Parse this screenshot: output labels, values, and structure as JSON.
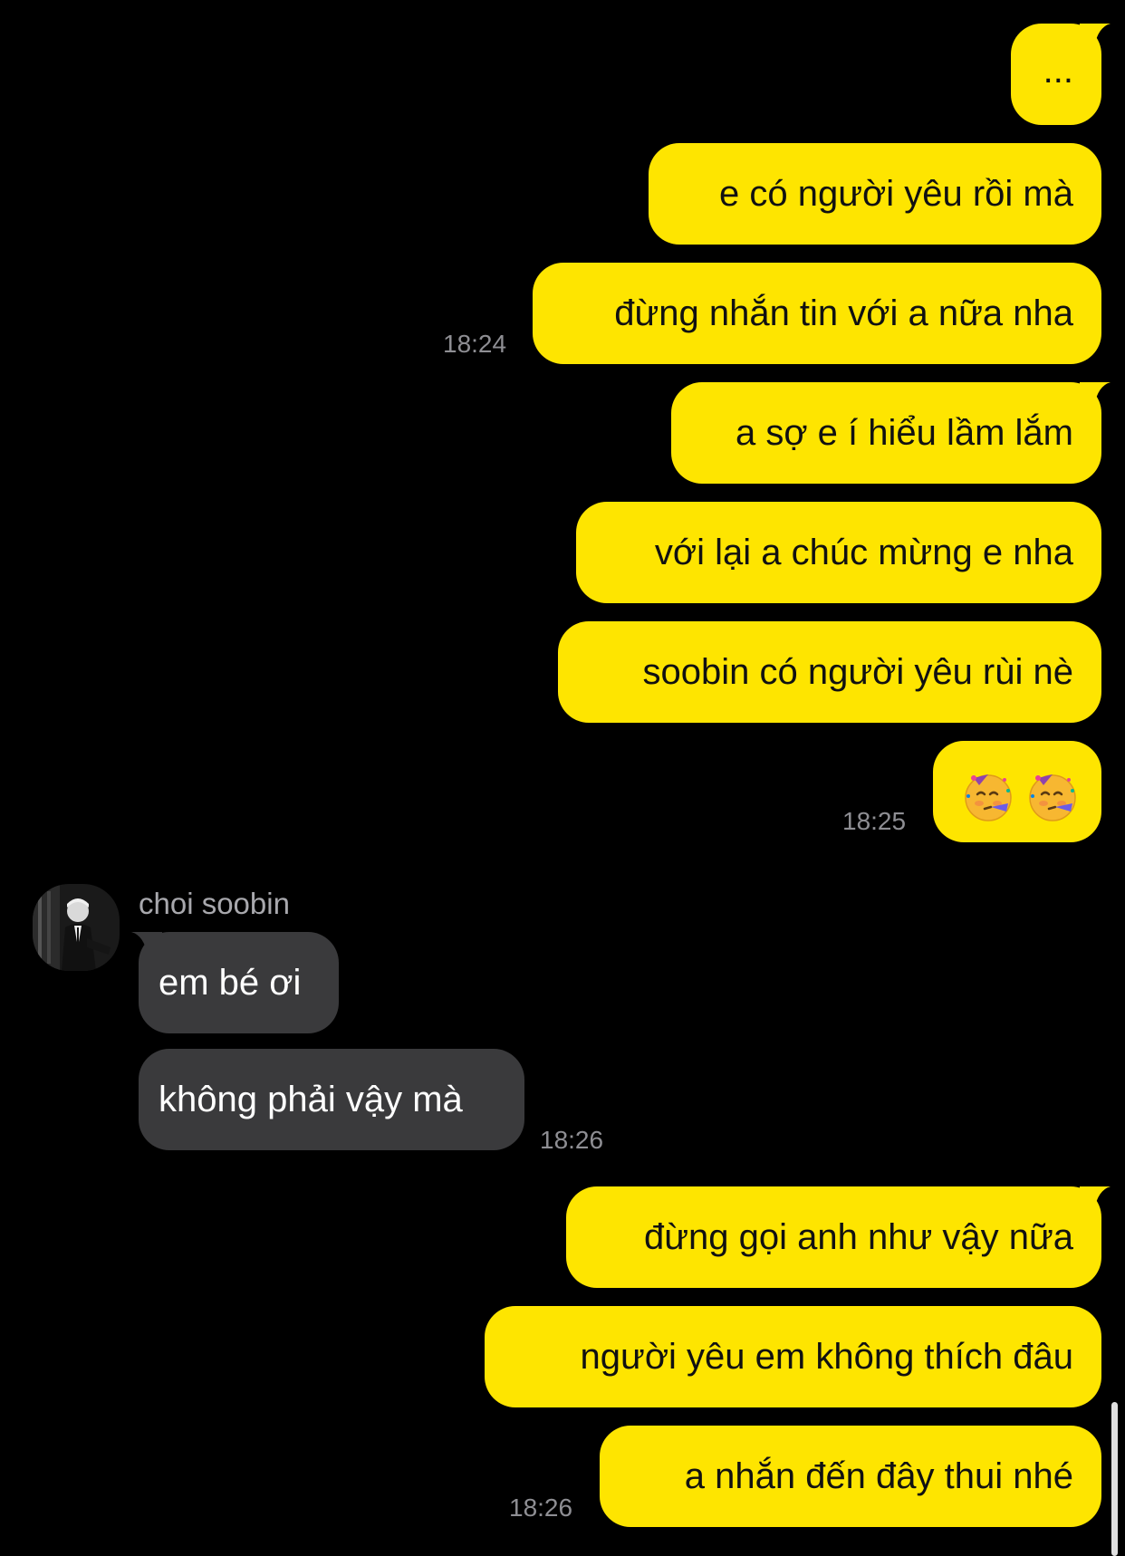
{
  "colors": {
    "background": "#000000",
    "outgoing_bubble": "#FEE500",
    "incoming_bubble": "#3a3a3c",
    "timestamp": "#8e8e93"
  },
  "messages": {
    "m1": "...",
    "m2": "e có người yêu rồi mà",
    "m3": "đừng nhắn tin với a nữa nha",
    "t1": "18:24",
    "m4": "a sợ e í hiểu lầm lắm",
    "m5": "với lại a chúc mừng e nha",
    "m6": "soobin có người yêu rùi nè",
    "m7_emoji": "partying-face-emoji x2",
    "t2": "18:25",
    "sender": "choi soobin",
    "m8": "em bé ơi",
    "m9": "không phải vậy mà",
    "t3": "18:26",
    "m10": "đừng gọi anh như vậy nữa",
    "m11": "người yêu em không thích đâu",
    "m12": "a nhắn đến đây thui nhé",
    "t4": "18:26"
  }
}
